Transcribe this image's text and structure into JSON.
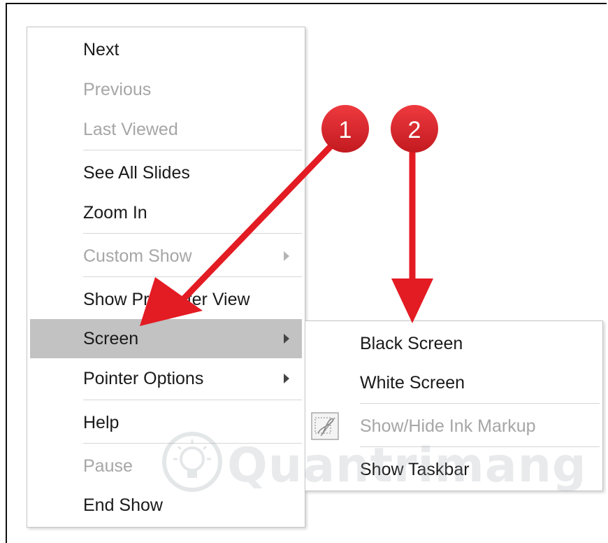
{
  "main_menu": {
    "items": [
      {
        "label": "Next",
        "disabled": false
      },
      {
        "label": "Previous",
        "disabled": true
      },
      {
        "label": "Last Viewed",
        "disabled": true
      },
      {
        "label": "See All Slides",
        "disabled": false
      },
      {
        "label": "Zoom In",
        "disabled": false
      },
      {
        "label": "Custom Show",
        "disabled": true,
        "submenu": true
      },
      {
        "label": "Show Presenter View",
        "disabled": false
      },
      {
        "label": "Screen",
        "disabled": false,
        "submenu": true,
        "highlighted": true
      },
      {
        "label": "Pointer Options",
        "disabled": false,
        "submenu": true
      },
      {
        "label": "Help",
        "disabled": false
      },
      {
        "label": "Pause",
        "disabled": true
      },
      {
        "label": "End Show",
        "disabled": false
      }
    ]
  },
  "screen_submenu": {
    "items": [
      {
        "label": "Black Screen",
        "disabled": false
      },
      {
        "label": "White Screen",
        "disabled": false
      },
      {
        "label": "Show/Hide Ink Markup",
        "disabled": true,
        "icon": "ink-markup-icon"
      },
      {
        "label": "Show Taskbar",
        "disabled": false
      }
    ]
  },
  "annotations": {
    "badges": [
      "1",
      "2"
    ],
    "arrow_color": "#e31b23"
  },
  "watermark": {
    "text": "Quantrimang",
    "icon": "lightbulb-icon"
  },
  "colors": {
    "highlight": "#c2c2c2",
    "disabled_text": "#a6a6a6",
    "badge": "#d7252c"
  }
}
